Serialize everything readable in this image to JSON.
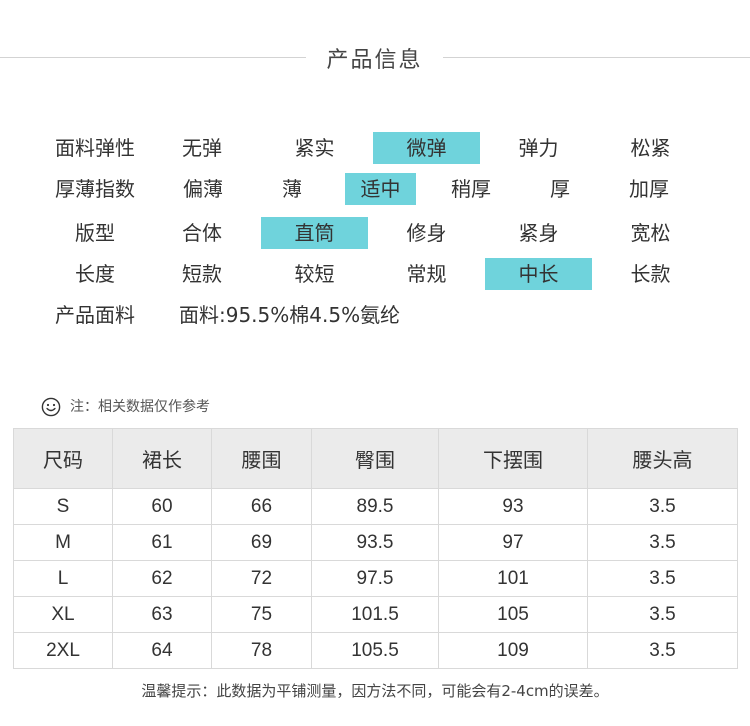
{
  "title": "产品信息",
  "attributes": [
    {
      "label": "面料弹性",
      "options": [
        "无弹",
        "紧实",
        "微弹",
        "弹力",
        "松紧"
      ],
      "selected": 2
    },
    {
      "label": "厚薄指数",
      "options": [
        "偏薄",
        "薄",
        "适中",
        "稍厚",
        "厚",
        "加厚"
      ],
      "selected": 2
    },
    {
      "label": "版型",
      "options": [
        "合体",
        "直筒",
        "修身",
        "紧身",
        "宽松"
      ],
      "selected": 1
    },
    {
      "label": "长度",
      "options": [
        "短款",
        "较短",
        "常规",
        "中长",
        "长款"
      ],
      "selected": 3
    }
  ],
  "fabric": {
    "label": "产品面料",
    "value": "面料:95.5%棉4.5%氨纶"
  },
  "note": {
    "icon": "smiley-icon",
    "text": "注：相关数据仅作参考"
  },
  "size_table": {
    "headers": [
      "尺码",
      "裙长",
      "腰围",
      "臀围",
      "下摆围",
      "腰头高"
    ],
    "rows": [
      [
        "S",
        "60",
        "66",
        "89.5",
        "93",
        "3.5"
      ],
      [
        "M",
        "61",
        "69",
        "93.5",
        "97",
        "3.5"
      ],
      [
        "L",
        "62",
        "72",
        "97.5",
        "101",
        "3.5"
      ],
      [
        "XL",
        "63",
        "75",
        "101.5",
        "105",
        "3.5"
      ],
      [
        "2XL",
        "64",
        "78",
        "105.5",
        "109",
        "3.5"
      ]
    ]
  },
  "footer": "温馨提示：此数据为平铺测量，因方法不同，可能会有2-4cm的误差。",
  "colors": {
    "highlight": "#6fd3dc",
    "header_bg": "#ebebeb",
    "border": "#d9d9d9"
  }
}
